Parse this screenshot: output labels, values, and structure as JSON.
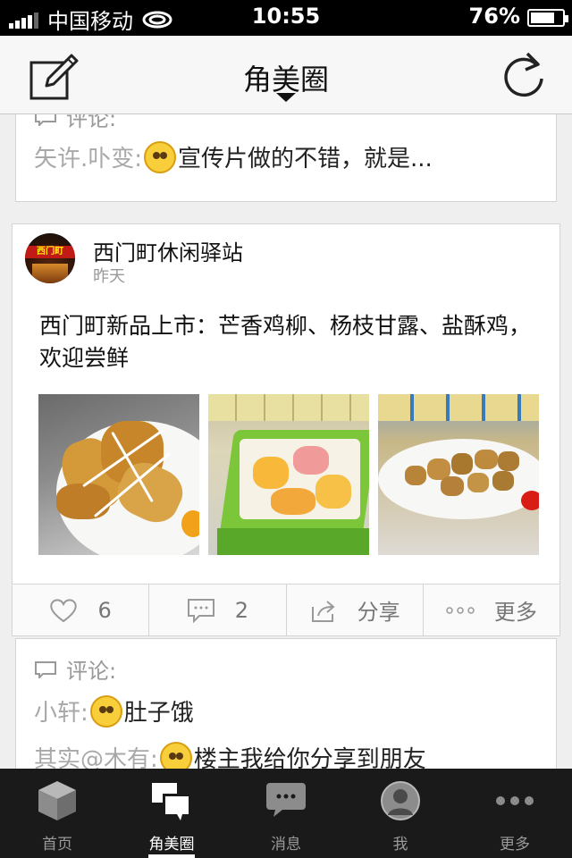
{
  "status_bar": {
    "carrier": "中国移动",
    "time": "10:55",
    "battery": "76%",
    "battery_level": 0.76
  },
  "nav": {
    "title": "角美圈",
    "compose_icon": "compose-icon",
    "refresh_icon": "refresh-icon"
  },
  "top_card": {
    "comment_label": "评论:",
    "comment": {
      "user": "矢许.卟变:",
      "text": "宣传片做的不错，就是..."
    }
  },
  "post": {
    "name": "西门町休闲驿站",
    "time": "昨天",
    "avatar_sign": "西门町",
    "text": "西门町新品上市：芒香鸡柳、杨枝甘露、盐酥鸡，欢迎尝鲜",
    "photos": [
      "芒香鸡柳",
      "杨枝甘露",
      "盐酥鸡"
    ],
    "actions": {
      "likes": "6",
      "comments": "2",
      "share": "分享",
      "more": "更多"
    }
  },
  "comments_card": {
    "label": "评论:",
    "items": [
      {
        "user": "小轩:",
        "text": "肚子饿"
      },
      {
        "user": "其实@木有:",
        "text": "楼主我给你分享到朋友"
      }
    ]
  },
  "tabbar": {
    "items": [
      {
        "label": "首页",
        "icon": "cube-icon"
      },
      {
        "label": "角美圈",
        "icon": "chat-bubbles-icon"
      },
      {
        "label": "消息",
        "icon": "message-icon"
      },
      {
        "label": "我",
        "icon": "user-icon"
      },
      {
        "label": "更多",
        "icon": "more-dots-icon"
      }
    ],
    "active_index": 1
  }
}
